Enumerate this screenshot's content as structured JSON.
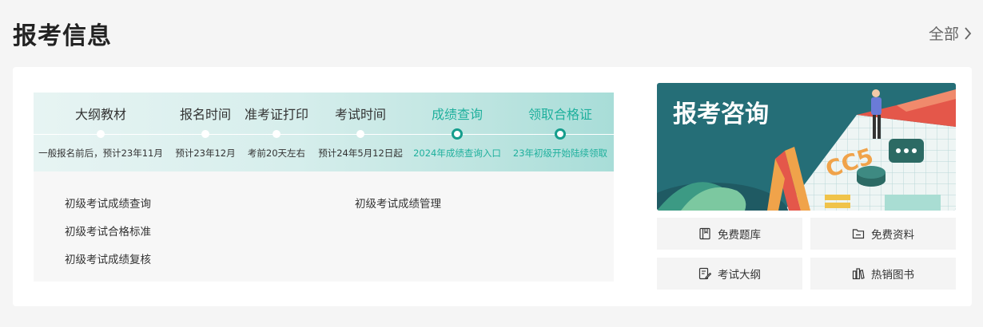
{
  "header": {
    "title": "报考信息",
    "more_label": "全部"
  },
  "steps": [
    {
      "label": "大纲教材",
      "desc": "一般报名前后，预计23年11月",
      "active": false
    },
    {
      "label": "报名时间",
      "desc": "预计23年12月",
      "active": false
    },
    {
      "label": "准考证打印",
      "desc": "考前20天左右",
      "active": false
    },
    {
      "label": "考试时间",
      "desc": "预计24年5月12日起",
      "active": false
    },
    {
      "label": "成绩查询",
      "desc": "2024年成绩查询入口",
      "active": true
    },
    {
      "label": "领取合格证",
      "desc": "23年初级开始陆续领取",
      "active": true
    }
  ],
  "links": [
    "初级考试成绩查询",
    "初级考试合格标准",
    "初级考试成绩复核",
    "初级考试成绩管理"
  ],
  "banner": {
    "title": "报考咨询",
    "art_text": "CC5"
  },
  "quick_buttons": [
    {
      "label": "免费题库",
      "icon": "book-icon"
    },
    {
      "label": "免费资料",
      "icon": "folder-icon"
    },
    {
      "label": "考试大纲",
      "icon": "edit-document-icon"
    },
    {
      "label": "热销图书",
      "icon": "books-icon"
    }
  ],
  "colors": {
    "accent": "#1fb09d",
    "accent_dark": "#159d8c",
    "banner_bg": "#256e77"
  }
}
